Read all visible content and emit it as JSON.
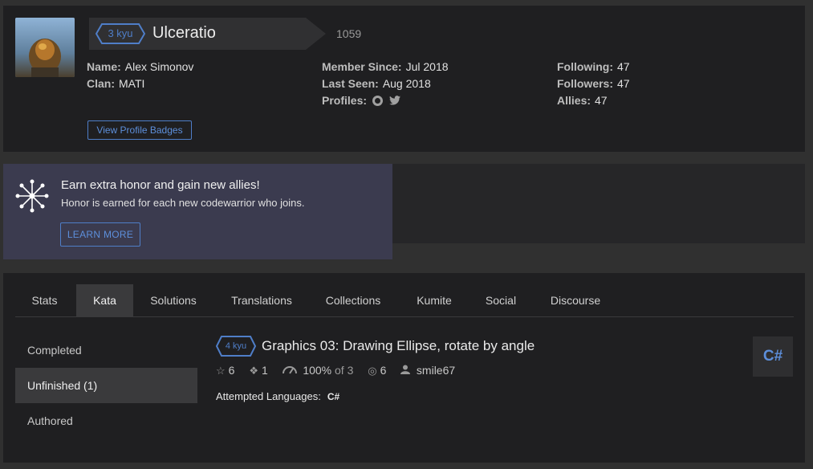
{
  "profile": {
    "rank": "3 kyu",
    "username": "Ulceratio",
    "honor": "1059",
    "name_label": "Name:",
    "name_value": "Alex Simonov",
    "clan_label": "Clan:",
    "clan_value": "MATI",
    "member_since_label": "Member Since:",
    "member_since_value": "Jul 2018",
    "last_seen_label": "Last Seen:",
    "last_seen_value": "Aug 2018",
    "profiles_label": "Profiles:",
    "following_label": "Following:",
    "following_value": "47",
    "followers_label": "Followers:",
    "followers_value": "47",
    "allies_label": "Allies:",
    "allies_value": "47",
    "badges_button": "View Profile Badges"
  },
  "promo": {
    "title": "Earn extra honor and gain new allies!",
    "subtitle": "Honor is earned for each new codewarrior who joins.",
    "button": "LEARN MORE"
  },
  "tabs": [
    "Stats",
    "Kata",
    "Solutions",
    "Translations",
    "Collections",
    "Kumite",
    "Social",
    "Discourse"
  ],
  "active_tab": "Kata",
  "sidenav": [
    "Completed",
    "Unfinished (1)",
    "Authored"
  ],
  "active_sidenav": "Unfinished (1)",
  "kata": {
    "rank": "4 kyu",
    "title": "Graphics 03: Drawing Ellipse, rotate by angle",
    "stars": "6",
    "collections": "1",
    "satisfaction": "100%",
    "satisfaction_of": "of 3",
    "completed": "6",
    "author": "smile67",
    "attempted_label": "Attempted Languages:",
    "language_icon": "C#"
  },
  "colors": {
    "accent": "#4f7ec8",
    "promo_bg": "#3b3b4f",
    "panel_bg": "#1f1f21"
  }
}
